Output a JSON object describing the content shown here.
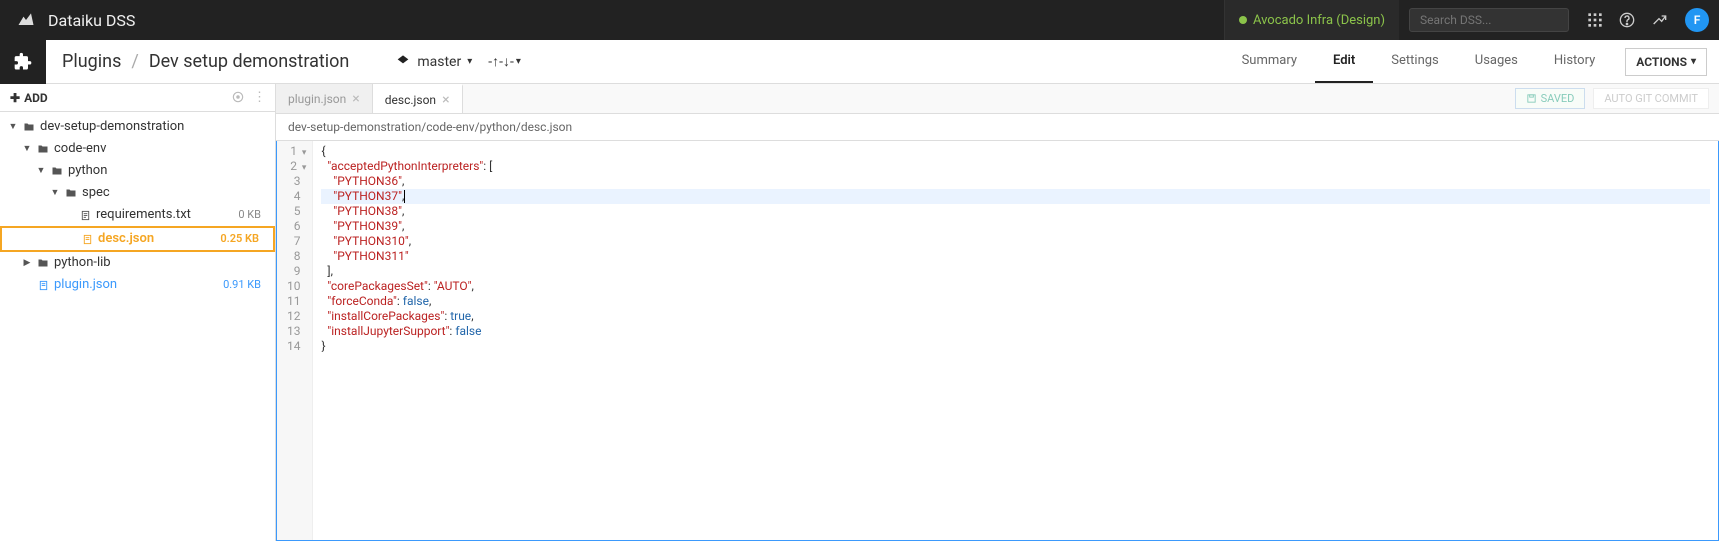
{
  "topbar": {
    "app_title": "Dataiku DSS",
    "project_badge": "Avocado Infra (Design)",
    "search_placeholder": "Search DSS...",
    "avatar_letter": "F"
  },
  "header": {
    "breadcrumb_root": "Plugins",
    "breadcrumb_current": "Dev setup demonstration",
    "branch": "master",
    "sort_label": "-↑-↓-",
    "nav": {
      "summary": "Summary",
      "edit": "Edit",
      "settings": "Settings",
      "usages": "Usages",
      "history": "History"
    },
    "actions": "ACTIONS"
  },
  "sidebar": {
    "add_label": "ADD",
    "tree": {
      "root": "dev-setup-demonstration",
      "codeenv": "code-env",
      "python": "python",
      "spec": "spec",
      "requirements": {
        "name": "requirements.txt",
        "size": "0 KB"
      },
      "desc": {
        "name": "desc.json",
        "size": "0.25 KB"
      },
      "pythonlib": "python-lib",
      "pluginjson": {
        "name": "plugin.json",
        "size": "0.91 KB"
      }
    }
  },
  "tabs": {
    "tab1": "plugin.json",
    "tab2": "desc.json"
  },
  "buttons": {
    "saved": "SAVED",
    "commit": "AUTO GIT COMMIT"
  },
  "path": "dev-setup-demonstration/code-env/python/desc.json",
  "code": {
    "l1": "{",
    "l2_key": "\"acceptedPythonInterpreters\"",
    "l2_rest": ": [",
    "l3": "\"PYTHON36\"",
    "l4": "\"PYTHON37\"",
    "l5": "\"PYTHON38\"",
    "l6": "\"PYTHON39\"",
    "l7": "\"PYTHON310\"",
    "l8": "\"PYTHON311\"",
    "l9": "  ],",
    "l10_key": "\"corePackagesSet\"",
    "l10_val": "\"AUTO\"",
    "l11_key": "\"forceConda\"",
    "l11_val": "false",
    "l12_key": "\"installCorePackages\"",
    "l12_val": "true",
    "l13_key": "\"installJupyterSupport\"",
    "l13_val": "false",
    "l14": "}"
  }
}
